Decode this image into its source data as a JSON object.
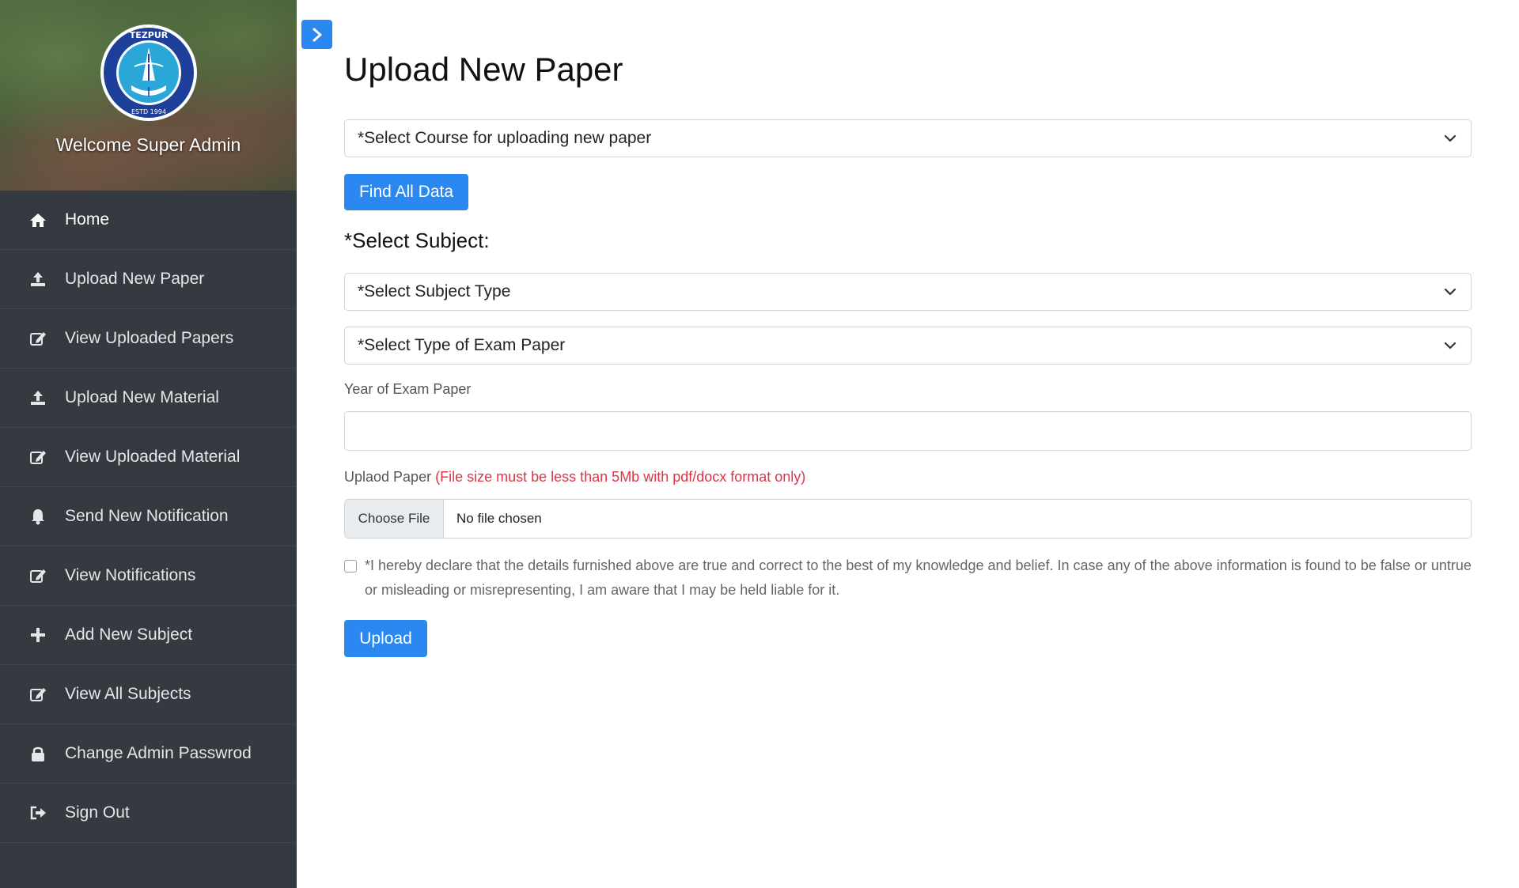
{
  "sidebar": {
    "logo_text": "TEZPUR UNIVERSITY ESTD 1994",
    "welcome": "Welcome Super Admin",
    "items": [
      {
        "label": "Home",
        "icon": "home-icon"
      },
      {
        "label": "Upload New Paper",
        "icon": "upload-icon"
      },
      {
        "label": "View Uploaded Papers",
        "icon": "edit-icon"
      },
      {
        "label": "Upload New Material",
        "icon": "upload-icon"
      },
      {
        "label": "View Uploaded Material",
        "icon": "edit-icon"
      },
      {
        "label": "Send New Notification",
        "icon": "bell-icon"
      },
      {
        "label": "View Notifications",
        "icon": "edit-icon"
      },
      {
        "label": "Add New Subject",
        "icon": "plus-icon"
      },
      {
        "label": "View All Subjects",
        "icon": "edit-icon"
      },
      {
        "label": "Change Admin Passwrod",
        "icon": "lock-icon"
      },
      {
        "label": "Sign Out",
        "icon": "sign-out-icon"
      }
    ]
  },
  "main": {
    "title": "Upload New Paper",
    "course_select": "*Select Course for uploading new paper",
    "find_button": "Find All Data",
    "subject_heading": "*Select Subject:",
    "subject_type_select": "*Select Subject Type",
    "exam_type_select": "*Select Type of Exam Paper",
    "year_label": "Year of Exam Paper",
    "year_value": "",
    "upload_label": "Uplaod Paper",
    "upload_note": "(File size must be less than 5Mb with pdf/docx format only)",
    "choose_file": "Choose File",
    "file_status": "No file chosen",
    "declaration": "*I hereby declare that the details furnished above are true and correct to the best of my knowledge and belief. In case any of the above information is found to be false or untrue or misleading or misrepresenting, I am aware that I may be held liable for it.",
    "upload_button": "Upload"
  },
  "colors": {
    "sidebar_bg": "#343a40",
    "accent": "#2a88f0",
    "warning_text": "#dc3545"
  }
}
